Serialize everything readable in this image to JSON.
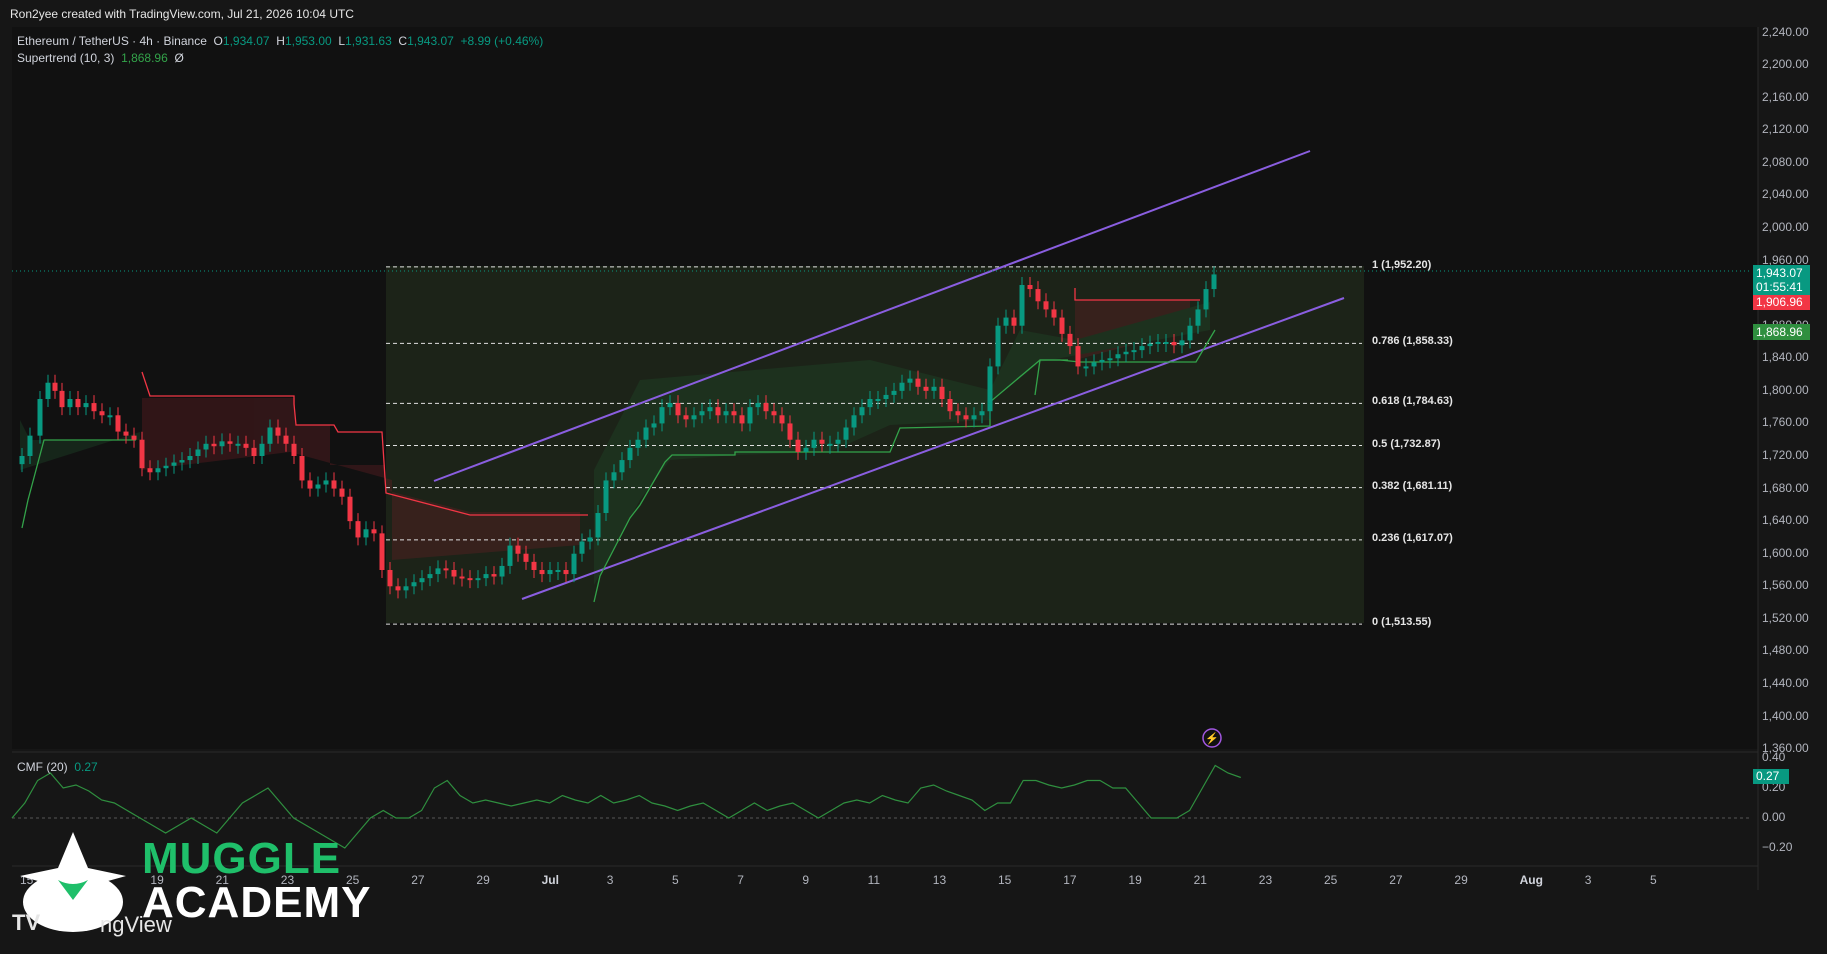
{
  "header": {
    "credit": "Ron2yee created with TradingView.com, Jul 21, 2026 10:04 UTC"
  },
  "legend": {
    "symbol": "Ethereum / TetherUS · 4h · Binance",
    "open_label": "O",
    "open": "1,934.07",
    "high_label": "H",
    "high": "1,953.00",
    "low_label": "L",
    "low": "1,931.63",
    "close_label": "C",
    "close": "1,943.07",
    "change": "+8.99 (+0.46%)",
    "supertrend_label": "Supertrend (10, 3)",
    "supertrend_value": "1,868.96",
    "supertrend_extra": "Ø"
  },
  "price_axis": [
    "2,240.00",
    "2,200.00",
    "2,160.00",
    "2,120.00",
    "2,080.00",
    "2,040.00",
    "2,000.00",
    "1,960.00",
    "1,880.00",
    "1,840.00",
    "1,800.00",
    "1,760.00",
    "1,720.00",
    "1,680.00",
    "1,640.00",
    "1,600.00",
    "1,560.00",
    "1,520.00",
    "1,480.00",
    "1,440.00",
    "1,400.00",
    "1,360.00"
  ],
  "price_tags": {
    "last": "1,943.07",
    "countdown": "01:55:41",
    "red": "1,906.96",
    "supertrend": "1,868.96",
    "colors": {
      "last": "#089981",
      "red": "#f23645",
      "supertrend": "#2f8f3f"
    }
  },
  "fib_levels": [
    {
      "label": "1 (1,952.20)",
      "price": 1952.2
    },
    {
      "label": "0.786 (1,858.33)",
      "price": 1858.33
    },
    {
      "label": "0.618 (1,784.63)",
      "price": 1784.63
    },
    {
      "label": "0.5 (1,732.87)",
      "price": 1732.87
    },
    {
      "label": "0.382 (1,681.11)",
      "price": 1681.11
    },
    {
      "label": "0.236 (1,617.07)",
      "price": 1617.07
    },
    {
      "label": "0 (1,513.55)",
      "price": 1513.55
    }
  ],
  "cmf": {
    "label": "CMF (20)",
    "value": "0.27",
    "axis": [
      "0.40",
      "0.20",
      "0.00",
      "−0.20"
    ],
    "tag_color": "#089981"
  },
  "time_axis": [
    "15",
    "17",
    "19",
    "21",
    "23",
    "25",
    "27",
    "29",
    "Jul",
    "3",
    "5",
    "7",
    "9",
    "11",
    "13",
    "15",
    "17",
    "19",
    "21",
    "23",
    "25",
    "27",
    "29",
    "Aug",
    "3",
    "5"
  ],
  "watermark": {
    "line1": "MUGGLE",
    "line2": "ACADEMY",
    "tv": "TV",
    "tv_text": "ngView"
  },
  "colors": {
    "up": "#089981",
    "down": "#f23645",
    "channel": "#7e57c2",
    "brand_green": "#1fbf6a"
  }
}
